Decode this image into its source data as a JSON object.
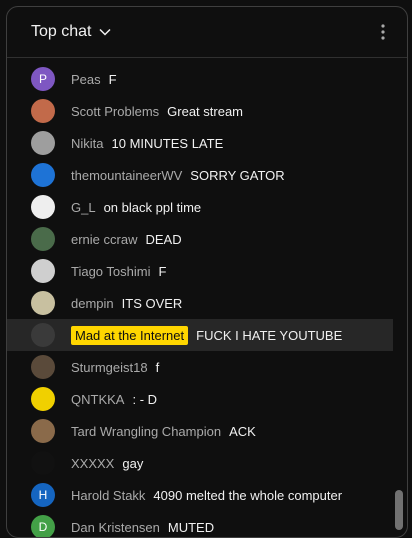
{
  "header": {
    "title": "Top chat",
    "chevron_icon": "chevron-down-icon",
    "more_icon": "more-vert-icon"
  },
  "messages": [
    {
      "author": "Peas",
      "text": "F",
      "avatar": {
        "letter": "P",
        "color": "#7e57c2"
      }
    },
    {
      "author": "Scott Problems",
      "text": "Great stream",
      "avatar": {
        "letter": "",
        "color": "#c26a4a"
      }
    },
    {
      "author": "Nikita",
      "text": "10 MINUTES LATE",
      "avatar": {
        "letter": "",
        "color": "#9e9e9e"
      }
    },
    {
      "author": "themountaineerWV",
      "text": "SORRY GATOR",
      "avatar": {
        "letter": "",
        "color": "#1e73d6"
      }
    },
    {
      "author": "G_L",
      "text": "on black ppl time",
      "avatar": {
        "letter": "",
        "color": "#eeeeee"
      }
    },
    {
      "author": "ernie ccraw",
      "text": "DEAD",
      "avatar": {
        "letter": "",
        "color": "#4a6b4a"
      }
    },
    {
      "author": "Tiago Toshimi",
      "text": "F",
      "avatar": {
        "letter": "",
        "color": "#cfcfcf"
      }
    },
    {
      "author": "dempin",
      "text": "ITS OVER",
      "avatar": {
        "letter": "",
        "color": "#c8c0a0"
      }
    },
    {
      "author": "Mad at the Internet",
      "text": "FUCK I HATE YOUTUBE",
      "avatar": {
        "letter": "",
        "color": "#3a3a3a"
      },
      "owner": true
    },
    {
      "author": "Sturmgeist18",
      "text": "f",
      "avatar": {
        "letter": "",
        "color": "#5a4a3a"
      }
    },
    {
      "author": "QNTKKA",
      "text": ": - D",
      "avatar": {
        "letter": "",
        "color": "#f0d000"
      }
    },
    {
      "author": "Tard Wrangling Champion",
      "text": "ACK",
      "avatar": {
        "letter": "",
        "color": "#8a6a4a"
      }
    },
    {
      "author": "XXXXX",
      "text": "gay",
      "avatar": {
        "letter": "",
        "color": "#111111"
      }
    },
    {
      "author": "Harold Stakk",
      "text": "4090 melted the whole computer",
      "avatar": {
        "letter": "H",
        "color": "#1565c0"
      }
    },
    {
      "author": "Dan Kristensen",
      "text": "MUTED",
      "avatar": {
        "letter": "D",
        "color": "#43a047"
      }
    }
  ]
}
